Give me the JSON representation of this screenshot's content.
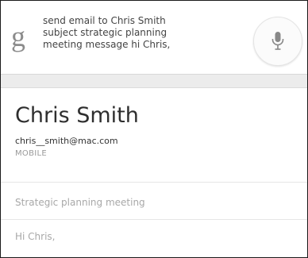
{
  "search": {
    "logo_letter": "g",
    "query_lines": [
      "send email to Chris Smith",
      "subject strategic planning",
      "meeting message hi Chris,"
    ],
    "mic_icon": "microphone-icon"
  },
  "contact": {
    "name": "Chris Smith",
    "email": "chris__smith@mac.com",
    "type": "MOBILE"
  },
  "email": {
    "subject": "Strategic planning meeting",
    "message": "Hi Chris,"
  },
  "colors": {
    "mic": "#888888",
    "band": "#ececec",
    "placeholder_text": "#a8a8a8"
  }
}
